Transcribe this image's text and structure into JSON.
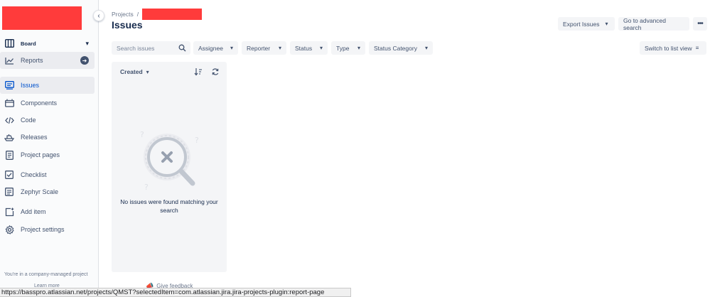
{
  "sidebar": {
    "board": {
      "label": "Board",
      "icon": "board-icon"
    },
    "reports": {
      "label": "Reports",
      "icon": "chart-line-icon"
    },
    "items": [
      {
        "label": "Issues",
        "icon": "issues-icon",
        "active": true
      },
      {
        "label": "Components",
        "icon": "components-icon"
      },
      {
        "label": "Code",
        "icon": "code-icon"
      },
      {
        "label": "Releases",
        "icon": "ship-icon"
      },
      {
        "label": "Project pages",
        "icon": "page-icon"
      },
      {
        "label": "Checklist",
        "icon": "checkbox-icon"
      },
      {
        "label": "Zephyr Scale",
        "icon": "zephyr-icon"
      },
      {
        "label": "Add item",
        "icon": "add-item-icon"
      },
      {
        "label": "Project settings",
        "icon": "gear-icon"
      }
    ],
    "company_note": "You're in a company-managed project",
    "learn_more": "Learn more"
  },
  "header": {
    "breadcrumb_root": "Projects",
    "breadcrumb_sep": "/",
    "title": "Issues",
    "export_label": "Export Issues",
    "advanced_search_label": "Go to advanced search",
    "more_label": "•••"
  },
  "filters": {
    "search_placeholder": "Search issues",
    "assignee": "Assignee",
    "reporter": "Reporter",
    "status": "Status",
    "type": "Type",
    "status_category": "Status Category",
    "switch_view": "Switch to list view"
  },
  "panel": {
    "sort_label": "Created",
    "empty_message": "No issues were found matching your search"
  },
  "feedback_label": "Give feedback",
  "status_url": "https://basspro.atlassian.net/projects/QMST?selectedItem=com.atlassian.jira.jira-projects-plugin:report-page",
  "colors": {
    "accent": "#0052cc",
    "redaction": "#ff3b3b",
    "sidebar_bg": "#fafbfc",
    "button_bg": "#f4f5f7"
  }
}
